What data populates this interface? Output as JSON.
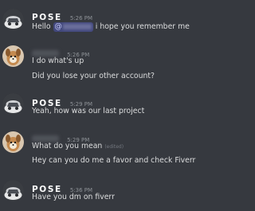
{
  "channel": {
    "messages": [
      {
        "author": "POSE",
        "time": "5:26 PM",
        "parts": {
          "before": "Hello ",
          "mention_prefix": "@",
          "after": " i hope you remember me"
        }
      },
      {
        "author": "",
        "time": "5:26 PM",
        "lines": [
          "I do what's up",
          "Did you lose your other account?"
        ]
      },
      {
        "author": "POSE",
        "time": "5:29 PM",
        "lines": [
          "Yeah, how was our last project"
        ]
      },
      {
        "author": "",
        "time": "5:29 PM",
        "lines": [
          "What do you mean",
          "Hey can you do me a favor and check Fiverr"
        ],
        "edited_label": "(edited)"
      },
      {
        "author": "POSE",
        "time": "5:36 PM",
        "lines": [
          "Have you dm on fiverr"
        ]
      }
    ]
  }
}
